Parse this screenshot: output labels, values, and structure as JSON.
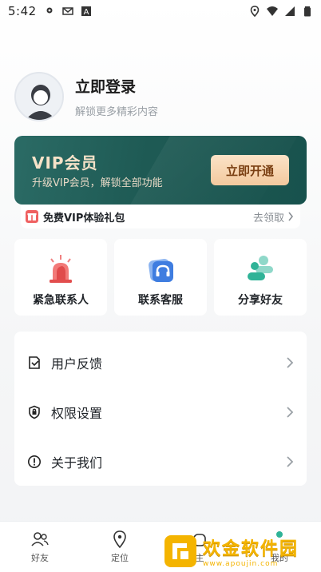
{
  "status_bar": {
    "time": "5:42",
    "left_icons": [
      "location-pin-icon",
      "gmail-icon",
      "a-box-icon"
    ],
    "right_icons": [
      "location-icon",
      "wifi-icon",
      "signal-icon",
      "battery-icon"
    ]
  },
  "profile": {
    "title": "立即登录",
    "subtitle": "解锁更多精彩内容"
  },
  "vip": {
    "title": "VIP会员",
    "subtitle": "升级VIP会员，解锁全部功能",
    "button": "立即开通",
    "colors": {
      "card": "#1e5a54",
      "title": "#f6e2c8",
      "button": "#f3c99e"
    }
  },
  "gift": {
    "text": "免费VIP体验礼包",
    "link": "去领取"
  },
  "actions": [
    {
      "label": "紧急联系人",
      "icon": "alarm-light-icon"
    },
    {
      "label": "联系客服",
      "icon": "headset-icon"
    },
    {
      "label": "分享好友",
      "icon": "share-friends-icon"
    }
  ],
  "menu": [
    {
      "label": "用户反馈",
      "icon": "feedback-icon"
    },
    {
      "label": "权限设置",
      "icon": "shield-icon"
    },
    {
      "label": "关于我们",
      "icon": "info-icon"
    }
  ],
  "tabbar": [
    {
      "label": "好友",
      "icon": "friends-icon"
    },
    {
      "label": "定位",
      "icon": "location-pin-icon"
    },
    {
      "label": "主",
      "icon": "home-icon"
    },
    {
      "label": "我的",
      "icon": "me-icon"
    }
  ],
  "watermark": {
    "main": "欢金软件园",
    "url": "www.apoujin.com"
  }
}
